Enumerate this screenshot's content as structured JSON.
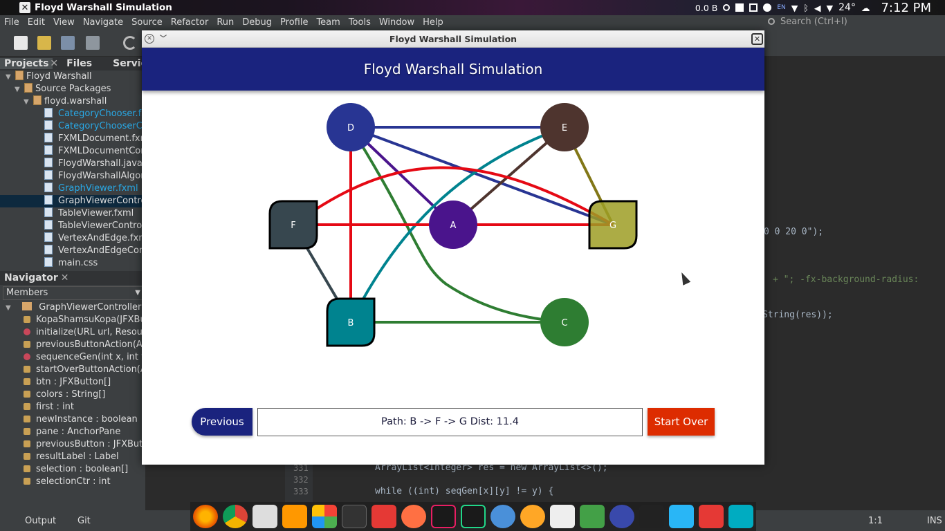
{
  "system_bar": {
    "window_title": "Floyd Warshall Simulation",
    "net_speed": "0.0 B",
    "keyboard": "EN",
    "temperature": "24°",
    "clock": "7:12 PM"
  },
  "menu": {
    "items": [
      "File",
      "Edit",
      "View",
      "Navigate",
      "Source",
      "Refactor",
      "Run",
      "Debug",
      "Profile",
      "Team",
      "Tools",
      "Window",
      "Help"
    ],
    "search_placeholder": "Search (Ctrl+I)"
  },
  "projects_panel": {
    "tabs": [
      "Projects",
      "Files",
      "Services"
    ],
    "tree": [
      {
        "label": "Floyd Warshall",
        "level": 0,
        "link": false,
        "selected": false
      },
      {
        "label": "Source Packages",
        "level": 1,
        "link": false,
        "selected": false
      },
      {
        "label": "floyd.warshall",
        "level": 2,
        "link": false,
        "selected": false
      },
      {
        "label": "CategoryChooser.fxml",
        "level": 3,
        "link": true,
        "selected": false
      },
      {
        "label": "CategoryChooserCont",
        "level": 3,
        "link": true,
        "selected": false
      },
      {
        "label": "FXMLDocument.fxml",
        "level": 3,
        "link": false,
        "selected": false
      },
      {
        "label": "FXMLDocumentContro",
        "level": 3,
        "link": false,
        "selected": false
      },
      {
        "label": "FloydWarshall.java",
        "level": 3,
        "link": false,
        "selected": false
      },
      {
        "label": "FloydWarshallAlgorith",
        "level": 3,
        "link": false,
        "selected": false
      },
      {
        "label": "GraphViewer.fxml",
        "level": 3,
        "link": true,
        "selected": false
      },
      {
        "label": "GraphViewerControlle",
        "level": 3,
        "link": false,
        "selected": true
      },
      {
        "label": "TableViewer.fxml",
        "level": 3,
        "link": false,
        "selected": false
      },
      {
        "label": "TableViewerController",
        "level": 3,
        "link": false,
        "selected": false
      },
      {
        "label": "VertexAndEdge.fxml",
        "level": 3,
        "link": false,
        "selected": false
      },
      {
        "label": "VertexAndEdgeContro",
        "level": 3,
        "link": false,
        "selected": false
      },
      {
        "label": "main.css",
        "level": 3,
        "link": false,
        "selected": false
      }
    ]
  },
  "navigator": {
    "title": "Navigator",
    "filter": "Members",
    "root": "GraphViewerController :: I",
    "members": [
      {
        "label": "KopaShamsuKopa(JFXBu",
        "kind": "field"
      },
      {
        "label": "initialize(URL url, Resour",
        "kind": "method"
      },
      {
        "label": "previousButtonAction(Ac",
        "kind": "field"
      },
      {
        "label": "sequenceGen(int x, int y",
        "kind": "method"
      },
      {
        "label": "startOverButtonAction(A",
        "kind": "field"
      },
      {
        "label": "btn : JFXButton[]",
        "kind": "field"
      },
      {
        "label": "colors : String[]",
        "kind": "field"
      },
      {
        "label": "first : int",
        "kind": "field"
      },
      {
        "label": "newInstance : boolean",
        "kind": "field"
      },
      {
        "label": "pane : AnchorPane",
        "kind": "field"
      },
      {
        "label": "previousButton : JFXButto",
        "kind": "field"
      },
      {
        "label": "resultLabel : Label",
        "kind": "field"
      },
      {
        "label": "selection : boolean[]",
        "kind": "field"
      },
      {
        "label": "selectionCtr : int",
        "kind": "field"
      }
    ]
  },
  "editor": {
    "fragments": [
      "0 0 20 0\");",
      "+ \"; -fx-background-radius:",
      "String(res));"
    ],
    "lines": [
      {
        "num": "331",
        "code": "ArrayList<Integer> res = new ArrayList<>();"
      },
      {
        "num": "332",
        "code": ""
      },
      {
        "num": "333",
        "code": "while ((int) seqGen[x][y] != y) {"
      }
    ]
  },
  "statusbar": {
    "output": "Output",
    "git": "Git",
    "position": "1:1",
    "mode": "INS"
  },
  "app": {
    "window_title": "Floyd Warshall Simulation",
    "header": "Floyd Warshall Simulation",
    "previous_label": "Previous",
    "path_text": "Path: B -> F -> G  Dist: 11.4",
    "start_over_label": "Start Over",
    "graph": {
      "nodes": [
        {
          "id": "D",
          "shape": "circle",
          "color": "#283593"
        },
        {
          "id": "E",
          "shape": "circle",
          "color": "#4e342e"
        },
        {
          "id": "F",
          "shape": "square",
          "color": "#37474f"
        },
        {
          "id": "A",
          "shape": "circle",
          "color": "#4a148c"
        },
        {
          "id": "G",
          "shape": "square",
          "color": "#9e9d24"
        },
        {
          "id": "B",
          "shape": "square",
          "color": "#00838f"
        },
        {
          "id": "C",
          "shape": "circle",
          "color": "#2e7d32"
        }
      ],
      "edges": [
        {
          "from": "D",
          "to": "E",
          "color": "#283593"
        },
        {
          "from": "D",
          "to": "G",
          "color": "#283593"
        },
        {
          "from": "D",
          "to": "A",
          "color": "#4a148c"
        },
        {
          "from": "D",
          "to": "B",
          "color": "#e50914"
        },
        {
          "from": "D",
          "to": "C",
          "color": "#2e7d32"
        },
        {
          "from": "E",
          "to": "A",
          "color": "#4e342e"
        },
        {
          "from": "E",
          "to": "B",
          "color": "#00838f"
        },
        {
          "from": "E",
          "to": "G",
          "color": "#827717"
        },
        {
          "from": "F",
          "to": "A",
          "color": "#e50914"
        },
        {
          "from": "A",
          "to": "G",
          "color": "#e50914"
        },
        {
          "from": "F",
          "to": "G",
          "color": "#e50914",
          "curved": true
        },
        {
          "from": "F",
          "to": "B",
          "color": "#37474f"
        },
        {
          "from": "B",
          "to": "C",
          "color": "#2e7d32"
        }
      ]
    }
  }
}
